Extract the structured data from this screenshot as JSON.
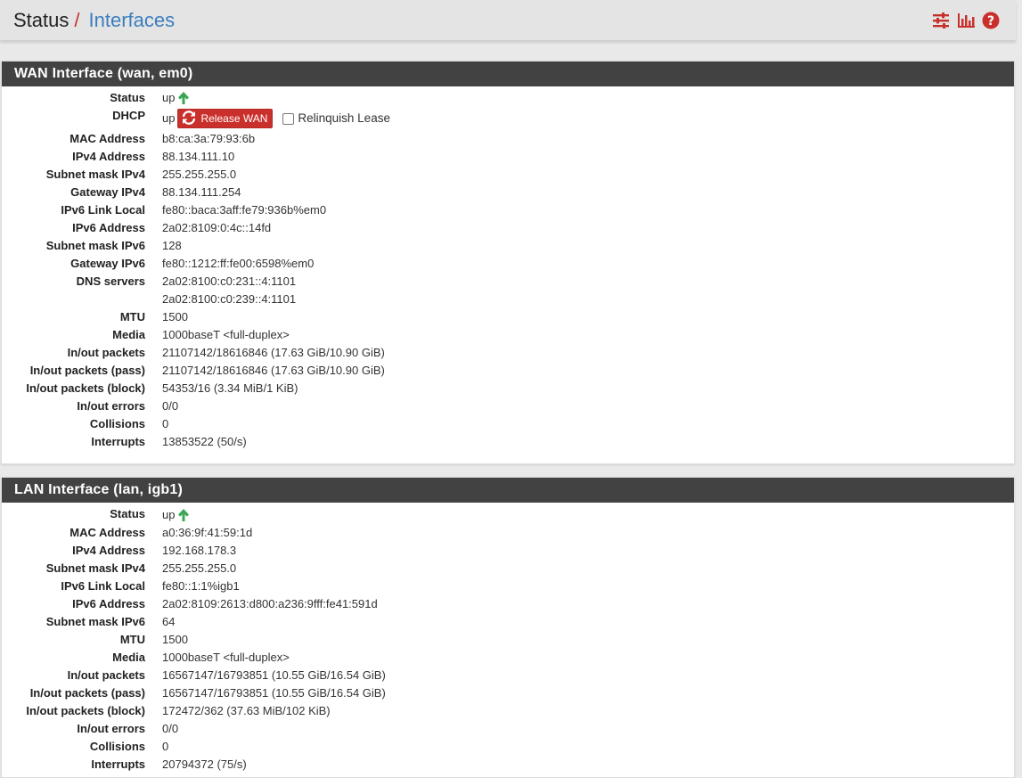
{
  "header": {
    "crumb_root": "Status",
    "crumb_sep": "/",
    "crumb_current": "Interfaces",
    "icons": [
      "settings-sliders-icon",
      "bar-chart-icon",
      "help-icon"
    ]
  },
  "colors": {
    "accent_red": "#c9302c",
    "link_blue": "#3a7ebf",
    "up_green": "#3aa655",
    "panel_heading": "#424242"
  },
  "wan": {
    "title": "WAN Interface (wan, em0)",
    "status_label": "Status",
    "status_value": "up",
    "dhcp_label": "DHCP",
    "dhcp_value": "up",
    "release_button": "Release WAN",
    "relinquish_label": "Relinquish Lease",
    "rows": [
      {
        "label": "MAC Address",
        "value": "b8:ca:3a:79:93:6b"
      },
      {
        "label": "IPv4 Address",
        "value": "88.134.111.10"
      },
      {
        "label": "Subnet mask IPv4",
        "value": "255.255.255.0"
      },
      {
        "label": "Gateway IPv4",
        "value": "88.134.111.254"
      },
      {
        "label": "IPv6 Link Local",
        "value": "fe80::baca:3aff:fe79:936b%em0"
      },
      {
        "label": "IPv6 Address",
        "value": "2a02:8109:0:4c::14fd"
      },
      {
        "label": "Subnet mask IPv6",
        "value": "128"
      },
      {
        "label": "Gateway IPv6",
        "value": "fe80::1212:ff:fe00:6598%em0"
      },
      {
        "label": "DNS servers",
        "value": "2a02:8100:c0:231::4:1101"
      },
      {
        "label": "",
        "value": "2a02:8100:c0:239::4:1101"
      },
      {
        "label": "MTU",
        "value": "1500"
      },
      {
        "label": "Media",
        "value": "1000baseT <full-duplex>"
      },
      {
        "label": "In/out packets",
        "value": "21107142/18616846 (17.63 GiB/10.90 GiB)"
      },
      {
        "label": "In/out packets (pass)",
        "value": "21107142/18616846 (17.63 GiB/10.90 GiB)"
      },
      {
        "label": "In/out packets (block)",
        "value": "54353/16 (3.34 MiB/1 KiB)"
      },
      {
        "label": "In/out errors",
        "value": "0/0"
      },
      {
        "label": "Collisions",
        "value": "0"
      },
      {
        "label": "Interrupts",
        "value": "13853522 (50/s)"
      }
    ]
  },
  "lan": {
    "title": "LAN Interface (lan, igb1)",
    "status_label": "Status",
    "status_value": "up",
    "rows": [
      {
        "label": "MAC Address",
        "value": "a0:36:9f:41:59:1d"
      },
      {
        "label": "IPv4 Address",
        "value": "192.168.178.3"
      },
      {
        "label": "Subnet mask IPv4",
        "value": "255.255.255.0"
      },
      {
        "label": "IPv6 Link Local",
        "value": "fe80::1:1%igb1"
      },
      {
        "label": "IPv6 Address",
        "value": "2a02:8109:2613:d800:a236:9fff:fe41:591d"
      },
      {
        "label": "Subnet mask IPv6",
        "value": "64"
      },
      {
        "label": "MTU",
        "value": "1500"
      },
      {
        "label": "Media",
        "value": "1000baseT <full-duplex>"
      },
      {
        "label": "In/out packets",
        "value": "16567147/16793851 (10.55 GiB/16.54 GiB)"
      },
      {
        "label": "In/out packets (pass)",
        "value": "16567147/16793851 (10.55 GiB/16.54 GiB)"
      },
      {
        "label": "In/out packets (block)",
        "value": "172472/362 (37.63 MiB/102 KiB)"
      },
      {
        "label": "In/out errors",
        "value": "0/0"
      },
      {
        "label": "Collisions",
        "value": "0"
      },
      {
        "label": "Interrupts",
        "value": "20794372 (75/s)"
      }
    ]
  }
}
